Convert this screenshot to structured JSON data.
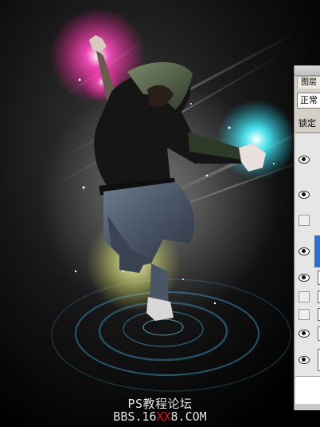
{
  "watermark": {
    "line1": "PS教程论坛",
    "line2_prefix": "BBS.16",
    "line2_red": "XX",
    "line2_suffix": "8.COM"
  },
  "layers_panel": {
    "tab_label": "图层",
    "blend_mode": "正常",
    "lock_label": "锁定",
    "layers": [
      {
        "visible": true
      },
      {
        "visible": true
      },
      {
        "visible": false
      },
      {
        "visible": true,
        "selected": true
      },
      {
        "visible": true
      },
      {
        "visible": false
      },
      {
        "visible": false
      },
      {
        "visible": true
      },
      {
        "visible": true
      }
    ]
  },
  "colors": {
    "glow_magenta": "#ff2aa8",
    "glow_cyan": "#3ef0ff",
    "glow_yellow": "#e8f070",
    "ring_blue": "#2e6f8e",
    "selection_blue": "#2f6fd3"
  }
}
